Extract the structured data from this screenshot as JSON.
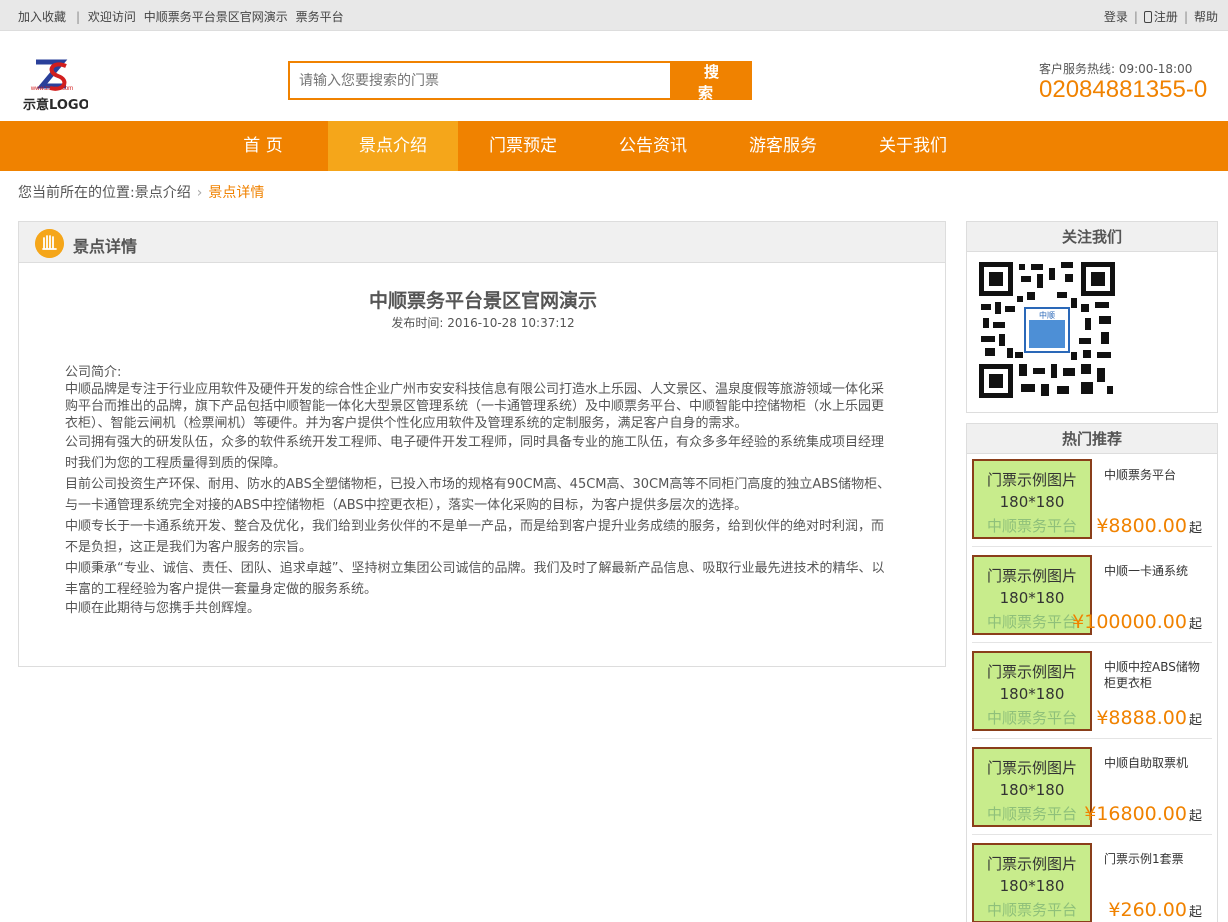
{
  "topbar": {
    "bookmark": "加入收藏",
    "welcome": "欢迎访问",
    "site_name": "中顺票务平台景区官网演示",
    "platform": "票务平台",
    "login": "登录",
    "register": "注册",
    "help": "帮助"
  },
  "logo": {
    "url_text": "www.zssss.com",
    "text": "示意LOGO"
  },
  "search": {
    "placeholder": "请输入您要搜索的门票",
    "button": "搜 索"
  },
  "hotline": {
    "label": "客户服务热线:  09:00-18:00",
    "number": "02084881355-0"
  },
  "nav": {
    "items": [
      {
        "label": "首 页"
      },
      {
        "label": "景点介绍"
      },
      {
        "label": "门票预定"
      },
      {
        "label": "公告资讯"
      },
      {
        "label": "游客服务"
      },
      {
        "label": "关于我们"
      }
    ]
  },
  "breadcrumb": {
    "prefix": "您当前所在的位置:",
    "parent": "景点介绍",
    "current": "景点详情"
  },
  "main": {
    "panel_title": "景点详情",
    "article_title": "中顺票务平台景区官网演示",
    "article_date": "发布时间: 2016-10-28 10:37:12",
    "paragraphs": [
      "公司简介:",
      "中顺品牌是专注于行业应用软件及硬件开发的综合性企业广州市安安科技信息有限公司打造水上乐园、人文景区、温泉度假等旅游领域一体化采购平台而推出的品牌，旗下产品包括中顺智能一体化大型景区管理系统（一卡通管理系统）及中顺票务平台、中顺智能中控储物柜（水上乐园更衣柜）、智能云闸机（检票闸机）等硬件。并为客户提供个性化应用软件及管理系统的定制服务，满足客户自身的需求。",
      "公司拥有强大的研发队伍，众多的软件系统开发工程师、电子硬件开发工程师，同时具备专业的施工队伍，有众多多年经验的系统集成项目经理时我们为您的工程质量得到质的保障。",
      "目前公司投资生产环保、耐用、防水的ABS全塑储物柜，已投入市场的规格有90CM高、45CM高、30CM高等不同柜门高度的独立ABS储物柜、与一卡通管理系统完全对接的ABS中控储物柜（ABS中控更衣柜），落实一体化采购的目标，为客户提供多层次的选择。",
      "中顺专长于一卡通系统开发、整合及优化，我们给到业务伙伴的不是单一产品，而是给到客户提升业务成绩的服务，给到伙伴的绝对时利润，而不是负担，这正是我们为客户服务的宗旨。",
      "中顺秉承“专业、诚信、责任、团队、追求卓越”、坚持树立集团公司诚信的品牌。我们及时了解最新产品信息、吸取行业最先进技术的精华、以丰富的工程经验为客户提供一套量身定做的服务系统。",
      "中顺在此期待与您携手共创辉煌。"
    ]
  },
  "sidebar": {
    "follow_title": "关注我们",
    "qr_center_text": "中顺",
    "hot_title": "热门推荐",
    "hot_items": [
      {
        "name": "中顺票务平台",
        "price": "¥8800.00",
        "unit": "起"
      },
      {
        "name": "中顺一卡通系统",
        "price": "¥100000.00",
        "unit": "起"
      },
      {
        "name": "中顺中控ABS储物柜更衣柜",
        "price": "¥8888.00",
        "unit": "起"
      },
      {
        "name": "中顺自助取票机",
        "price": "¥16800.00",
        "unit": "起"
      },
      {
        "name": "门票示例1套票",
        "price": "¥260.00",
        "unit": "起"
      }
    ],
    "thumb": {
      "line1": "门票示例图片",
      "line2": "180*180",
      "line3": "中顺票务平台"
    }
  }
}
